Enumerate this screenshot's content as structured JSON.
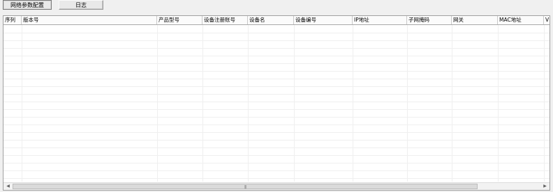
{
  "toolbar": {
    "tabs": [
      {
        "label": "网络参数配置"
      },
      {
        "label": "日志"
      }
    ]
  },
  "table": {
    "columns": [
      "序列",
      "版本号",
      "产品型号",
      "设备注册账号",
      "设备名",
      "设备编号",
      "IP地址",
      "子网掩码",
      "网关",
      "MAC地址",
      "V"
    ],
    "rows": []
  },
  "scrollbar": {
    "left_arrow": "◀",
    "right_arrow": "▶",
    "grip": "|||"
  }
}
